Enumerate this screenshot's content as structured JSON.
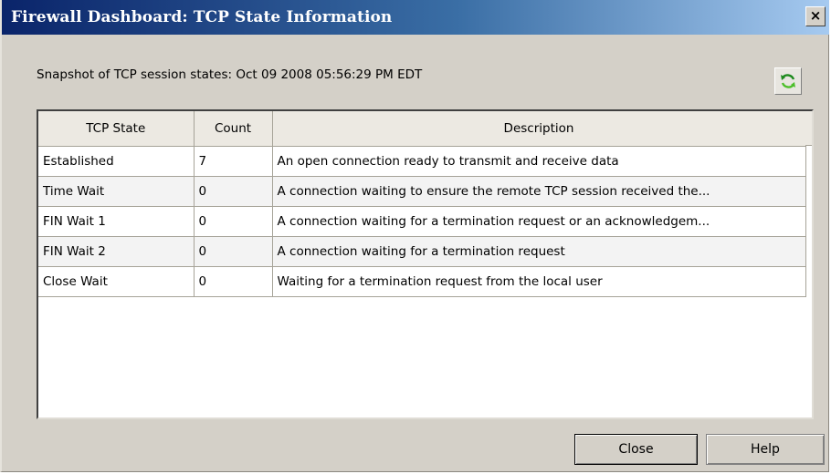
{
  "window": {
    "title": "Firewall Dashboard: TCP State Information",
    "close_glyph": "×"
  },
  "snapshot_text": "Snapshot of TCP session states: Oct 09 2008 05:56:29 PM EDT",
  "refresh_icon": "refresh-icon",
  "table": {
    "headers": [
      "TCP State",
      "Count",
      "Description"
    ],
    "rows": [
      {
        "state": "Established",
        "count": "7",
        "description": "An open connection ready to transmit and receive data"
      },
      {
        "state": "Time Wait",
        "count": "0",
        "description": "A connection waiting to ensure the remote TCP session received the..."
      },
      {
        "state": "FIN Wait 1",
        "count": "0",
        "description": "A connection waiting for a termination request or an acknowledgem..."
      },
      {
        "state": "FIN Wait 2",
        "count": "0",
        "description": "A connection waiting for a termination request"
      },
      {
        "state": "Close Wait",
        "count": "0",
        "description": "Waiting for a termination request from the local user"
      }
    ]
  },
  "buttons": {
    "close": "Close",
    "help": "Help"
  },
  "colors": {
    "title_start": "#0a246a",
    "title_end": "#a6caf0",
    "dialog_bg": "#d4d0c8"
  }
}
